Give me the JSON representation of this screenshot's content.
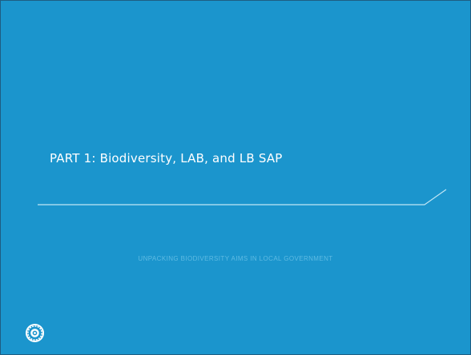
{
  "slide": {
    "title": "PART 1: Biodiversity, LAB, and LB SAP",
    "subtitle": "UNPACKING BIODIVERSITY AIMS IN LOCAL GOVERNMENT",
    "background_color": "#1b95cd",
    "accent_color": "#ffffff"
  },
  "logo": {
    "icon": "seal-logo-icon",
    "lines": [
      "",
      "",
      ""
    ]
  }
}
